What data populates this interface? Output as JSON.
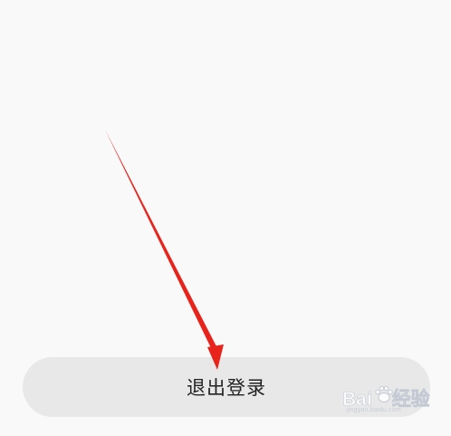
{
  "logout": {
    "label": "退出登录"
  },
  "annotation": {
    "color": "#e8231c"
  },
  "watermark": {
    "brand": "Bai",
    "brand_suffix": "经验",
    "url": "jingyan.baidu.com"
  }
}
